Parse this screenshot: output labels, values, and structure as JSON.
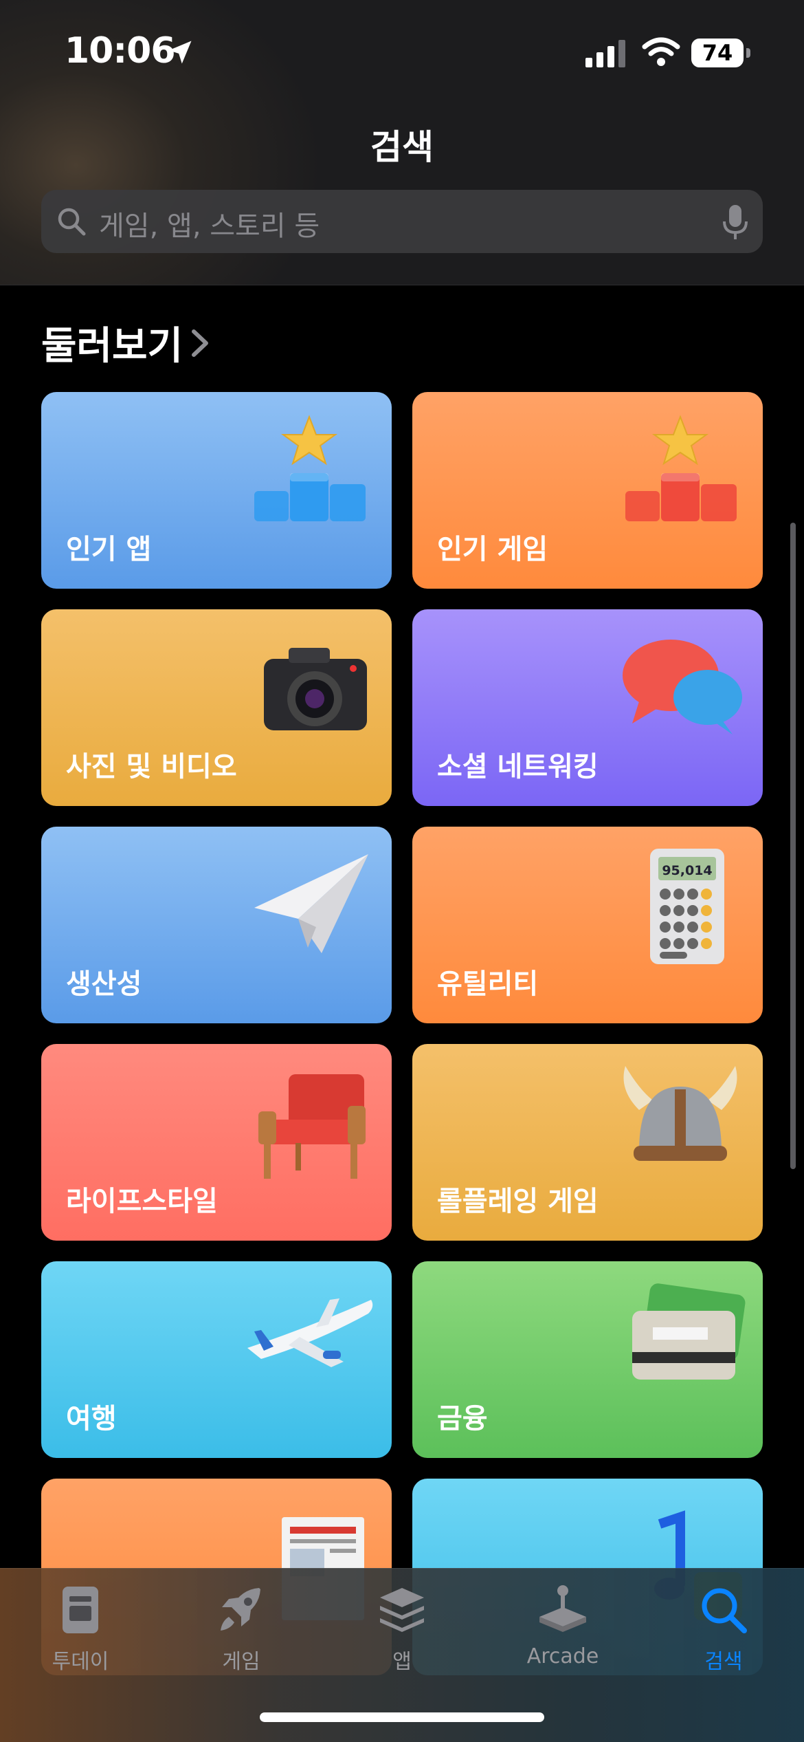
{
  "status_bar": {
    "time": "10:06",
    "battery": "74"
  },
  "header": {
    "title": "검색",
    "search_placeholder": "게임, 앱, 스토리 등"
  },
  "browse": {
    "title": "둘러보기",
    "categories": [
      {
        "label": "인기 앱",
        "color_top": "#8fc0f4",
        "color_bottom": "#5a9be8",
        "icon": "podium-star-icon"
      },
      {
        "label": "인기 게임",
        "color_top": "#ffa266",
        "color_bottom": "#ff8a3c",
        "icon": "podium-star-icon"
      },
      {
        "label": "사진 및 비디오",
        "color_top": "#f4c06a",
        "color_bottom": "#e9ab3e",
        "icon": "camera-icon"
      },
      {
        "label": "소셜 네트워킹",
        "color_top": "#a792fb",
        "color_bottom": "#7b66f5",
        "icon": "speech-bubbles-icon"
      },
      {
        "label": "생산성",
        "color_top": "#8fc0f4",
        "color_bottom": "#5a9be8",
        "icon": "paper-plane-icon"
      },
      {
        "label": "유틸리티",
        "color_top": "#ffa266",
        "color_bottom": "#ff8a3c",
        "icon": "calculator-icon",
        "calculator_display": "95,014"
      },
      {
        "label": "라이프스타일",
        "color_top": "#ff8a7e",
        "color_bottom": "#ff6e62",
        "icon": "armchair-icon"
      },
      {
        "label": "롤플레잉 게임",
        "color_top": "#f4c06a",
        "color_bottom": "#e9ab3e",
        "icon": "viking-helmet-icon"
      },
      {
        "label": "여행",
        "color_top": "#6fd6f5",
        "color_bottom": "#3bbde8",
        "icon": "airplane-icon"
      },
      {
        "label": "금융",
        "color_top": "#8ed97e",
        "color_bottom": "#5cc05a",
        "icon": "credit-card-icon"
      },
      {
        "label": "",
        "color_top": "#ffa266",
        "color_bottom": "#ff8a3c",
        "icon": "newspaper-icon"
      },
      {
        "label": "",
        "color_top": "#6fd6f5",
        "color_bottom": "#3bbde8",
        "icon": "music-notes-icon"
      }
    ]
  },
  "tab_bar": {
    "tabs": [
      {
        "label": "투데이",
        "icon": "today-icon",
        "active": false
      },
      {
        "label": "게임",
        "icon": "rocket-icon",
        "active": false
      },
      {
        "label": "앱",
        "icon": "stack-icon",
        "active": false
      },
      {
        "label": "Arcade",
        "icon": "joystick-icon",
        "active": false
      },
      {
        "label": "검색",
        "icon": "search-icon",
        "active": true
      }
    ]
  }
}
